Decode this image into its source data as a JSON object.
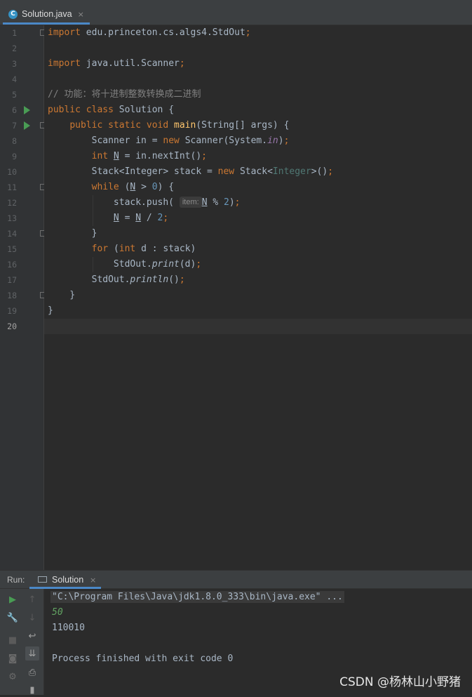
{
  "editor_tab": {
    "label": "Solution.java",
    "icon": "java-class-icon",
    "close": "×"
  },
  "code": {
    "line_numbers": [
      "1",
      "2",
      "3",
      "4",
      "5",
      "6",
      "7",
      "8",
      "9",
      "10",
      "11",
      "12",
      "13",
      "14",
      "15",
      "16",
      "17",
      "18",
      "19",
      "20"
    ],
    "current_line": 20,
    "import1": "edu.princeton.cs.algs4.StdOut",
    "import2": "java.util.Scanner",
    "comment": "// 功能：将十进制整数转换成二进制",
    "class_name": "Solution",
    "method_name": "main",
    "param_hint": "item:",
    "divisor": "2"
  },
  "run_panel": {
    "label": "Run:",
    "tab_label": "Solution",
    "tab_close": "×",
    "console": {
      "command": "\"C:\\Program Files\\Java\\jdk1.8.0_333\\bin\\java.exe\" ...",
      "input": "50",
      "output": "110010",
      "finished": "Process finished with exit code 0"
    }
  },
  "watermark": "CSDN @杨林山小野猪",
  "colors": {
    "keyword": "#cc7832",
    "number": "#6897bb",
    "function": "#ffc66d",
    "static_field": "#9876aa",
    "comment": "#808080",
    "run_green": "#499c54"
  }
}
